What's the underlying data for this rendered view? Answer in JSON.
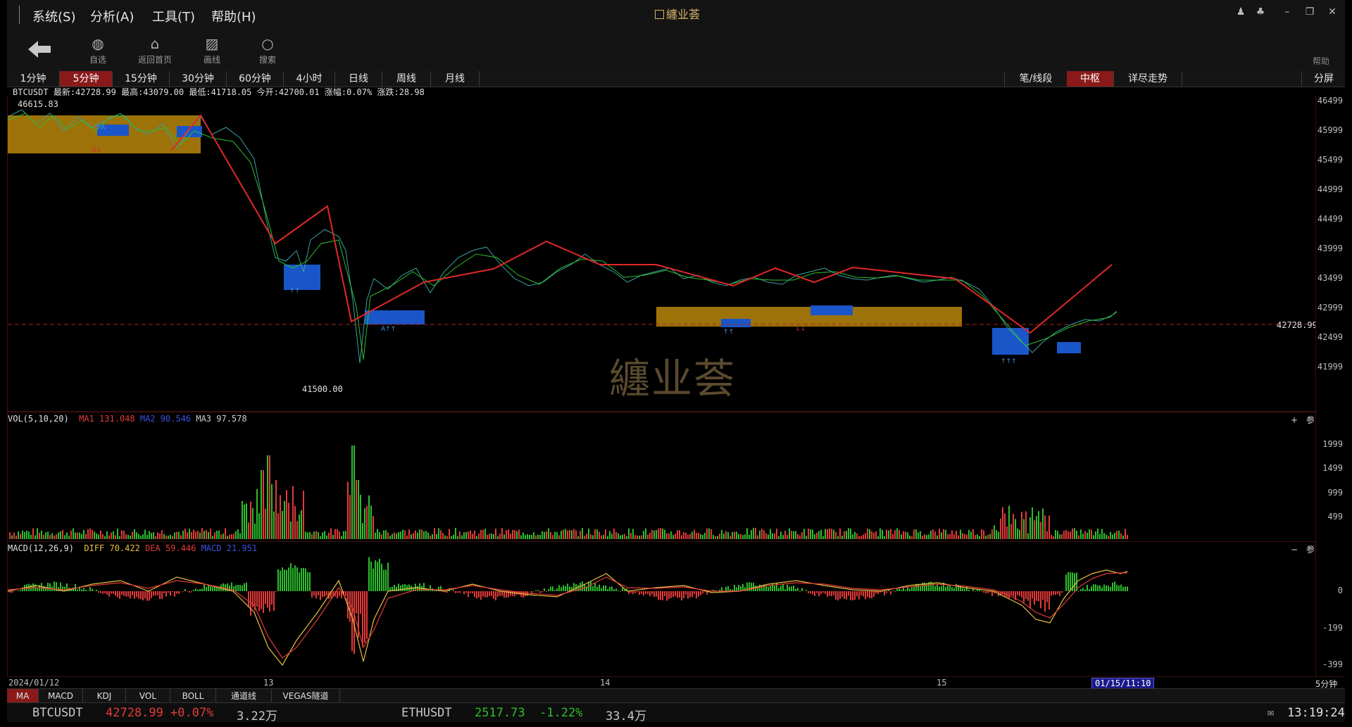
{
  "menu": [
    "系统(S)",
    "分析(A)",
    "工具(T)",
    "帮助(H)"
  ],
  "app_title": "纏业荟",
  "toolbar": {
    "back_icon": "back-arrow-icon",
    "items": [
      {
        "label": "自选",
        "icon": "watchlist-icon"
      },
      {
        "label": "返回首页",
        "icon": "home-icon"
      },
      {
        "label": "画线",
        "icon": "draw-line-icon"
      },
      {
        "label": "搜索",
        "icon": "search-icon"
      }
    ],
    "help": "帮助"
  },
  "periods": [
    "1分钟",
    "5分钟",
    "15分钟",
    "30分钟",
    "60分钟",
    "4小时",
    "日线",
    "周线",
    "月线"
  ],
  "active_period": "5分钟",
  "right_tabs": [
    "笔/线段",
    "中枢",
    "详尽走势"
  ],
  "active_right_tab": "中枢",
  "split_screen": "分屏",
  "info": {
    "symbol": "BTCUSDT",
    "latest": "最新:42728.99",
    "high": "最高:43079.00",
    "low": "最低:41718.05",
    "open": "今开:42700.01",
    "change_pct": "涨幅:0.07%",
    "change": "涨跌:28.98"
  },
  "price_axis": [
    "46499",
    "45999",
    "45499",
    "44999",
    "44499",
    "43999",
    "43499",
    "42999",
    "42499",
    "41999"
  ],
  "price_marks": {
    "high_label": "46615.83",
    "low_label": "41500.00",
    "last_price": "42728.99"
  },
  "watermark": "纏业荟",
  "vol": {
    "label": "VOL(5,10,20)",
    "ma1": "MA1 131.048",
    "ma2": "MA2 90.546",
    "ma3": "MA3 97.578",
    "axis": [
      "1999",
      "1499",
      "999",
      "499"
    ],
    "btn_plus": "+",
    "btn_param": "参"
  },
  "macd": {
    "label": "MACD(12,26,9)",
    "diff": "DIFF 70.422",
    "dea": "DEA 59.446",
    "macd": "MACD 21.951",
    "axis": [
      "0",
      "-199",
      "-399"
    ],
    "btn_minus": "−",
    "btn_param": "参"
  },
  "dates": [
    "2024/01/12",
    "13",
    "14",
    "15"
  ],
  "cursor_time": "01/15/11:10",
  "period_label": "5分钟",
  "indicators": [
    "MA",
    "MACD",
    "KDJ",
    "VOL",
    "BOLL",
    "通道线",
    "VEGAS隧道"
  ],
  "active_indicator": "MA",
  "ticker": [
    {
      "symbol": "BTCUSDT",
      "price": "42728.99",
      "change": "+0.07%",
      "volume": "3.22万"
    },
    {
      "symbol": "ETHUSDT",
      "price": "2517.73",
      "change": "-1.22%",
      "volume": "33.4万"
    }
  ],
  "clock": "13:19:24",
  "colors": {
    "up": "#e23a3a",
    "down": "#2ebd2e",
    "zone_gold": "#b8860b",
    "zone_blue": "#1a56c8",
    "accent_red": "#8a1a1a"
  }
}
